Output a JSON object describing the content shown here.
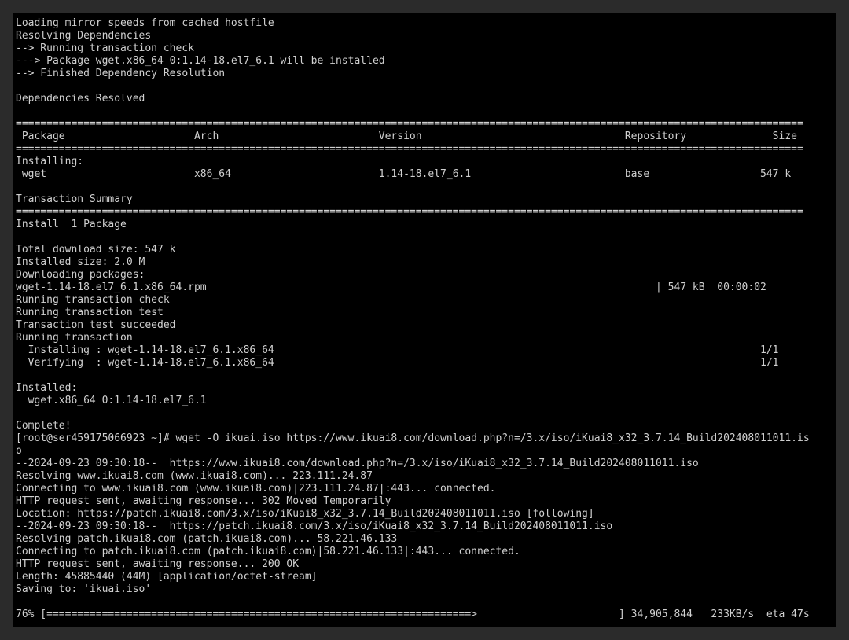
{
  "terminal": {
    "lines": [
      "Loading mirror speeds from cached hostfile",
      "Resolving Dependencies",
      "--> Running transaction check",
      "---> Package wget.x86_64 0:1.14-18.el7_6.1 will be installed",
      "--> Finished Dependency Resolution",
      "",
      "Dependencies Resolved",
      "",
      "================================================================================================================================",
      " Package                     Arch                          Version                                 Repository              Size",
      "================================================================================================================================",
      "Installing:",
      " wget                        x86_64                        1.14-18.el7_6.1                         base                  547 k",
      "",
      "Transaction Summary",
      "================================================================================================================================",
      "Install  1 Package",
      "",
      "Total download size: 547 k",
      "Installed size: 2.0 M",
      "Downloading packages:",
      "wget-1.14-18.el7_6.1.x86_64.rpm                                                                         | 547 kB  00:00:02",
      "Running transaction check",
      "Running transaction test",
      "Transaction test succeeded",
      "Running transaction",
      "  Installing : wget-1.14-18.el7_6.1.x86_64                                                                               1/1",
      "  Verifying  : wget-1.14-18.el7_6.1.x86_64                                                                               1/1",
      "",
      "Installed:",
      "  wget.x86_64 0:1.14-18.el7_6.1",
      "",
      "Complete!",
      "[root@ser459175066923 ~]# wget -O ikuai.iso https://www.ikuai8.com/download.php?n=/3.x/iso/iKuai8_x32_3.7.14_Build202408011011.is",
      "o",
      "--2024-09-23 09:30:18--  https://www.ikuai8.com/download.php?n=/3.x/iso/iKuai8_x32_3.7.14_Build202408011011.iso",
      "Resolving www.ikuai8.com (www.ikuai8.com)... 223.111.24.87",
      "Connecting to www.ikuai8.com (www.ikuai8.com)|223.111.24.87|:443... connected.",
      "HTTP request sent, awaiting response... 302 Moved Temporarily",
      "Location: https://patch.ikuai8.com/3.x/iso/iKuai8_x32_3.7.14_Build202408011011.iso [following]",
      "--2024-09-23 09:30:18--  https://patch.ikuai8.com/3.x/iso/iKuai8_x32_3.7.14_Build202408011011.iso",
      "Resolving patch.ikuai8.com (patch.ikuai8.com)... 58.221.46.133",
      "Connecting to patch.ikuai8.com (patch.ikuai8.com)|58.221.46.133|:443... connected.",
      "HTTP request sent, awaiting response... 200 OK",
      "Length: 45885440 (44M) [application/octet-stream]",
      "Saving to: 'ikuai.iso'",
      "",
      "76% [=====================================================================>                       ] 34,905,844   233KB/s  eta 47s"
    ]
  }
}
